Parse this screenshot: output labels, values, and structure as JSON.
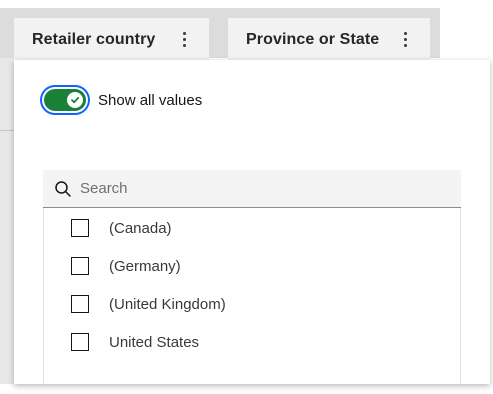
{
  "header": {
    "columns": [
      {
        "label": "Retailer country"
      },
      {
        "label": "Province or State"
      }
    ]
  },
  "filter": {
    "show_all_values_label": "Show all values",
    "show_all_values_on": true,
    "search": {
      "placeholder": "Search",
      "value": ""
    },
    "items": [
      {
        "label": "(Canada)",
        "checked": false
      },
      {
        "label": "(Germany)",
        "checked": false
      },
      {
        "label": "(United Kingdom)",
        "checked": false
      },
      {
        "label": "United States",
        "checked": false
      }
    ]
  },
  "colors": {
    "toggle_on": "#198038",
    "focus_ring": "#0f62fe"
  },
  "icons": {
    "menu": "overflow-menu-vertical-icon",
    "search": "search-icon",
    "check": "checkmark-icon"
  }
}
